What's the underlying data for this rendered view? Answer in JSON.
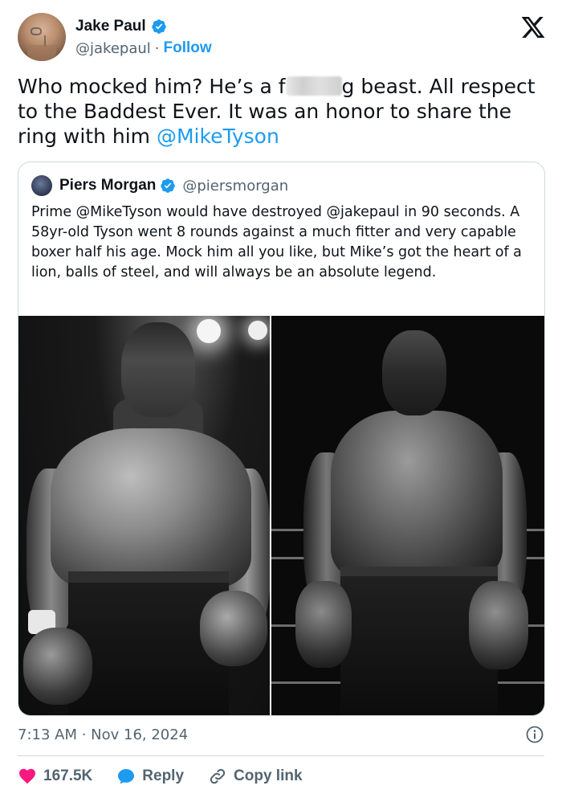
{
  "author": {
    "name": "Jake Paul",
    "handle": "@jakepaul",
    "separator": "·",
    "follow_label": "Follow"
  },
  "tweet": {
    "text_part1": "Who mocked him? He’s a f",
    "text_part2": "g beast. All respect to the Baddest Ever. It was an honor to share the ring with him ",
    "mention": "@MikeTyson"
  },
  "quote": {
    "name": "Piers Morgan",
    "handle": "@piersmorgan",
    "text": "Prime @MikeTyson would have destroyed @jakepaul in 90 seconds. A 58yr-old Tyson went 8 rounds against a much fitter and very capable boxer half his age. Mock him all you like, but Mike’s got the heart of a lion, balls of steel, and will always be an absolute legend."
  },
  "meta": {
    "timestamp": "7:13 AM · Nov 16, 2024"
  },
  "actions": {
    "likes": "167.5K",
    "reply_label": "Reply",
    "copy_label": "Copy link"
  },
  "colors": {
    "accent": "#1d9bf0",
    "like": "#f91880",
    "text": "#0f1419",
    "secondary": "#536471",
    "border": "#cfd9de"
  }
}
